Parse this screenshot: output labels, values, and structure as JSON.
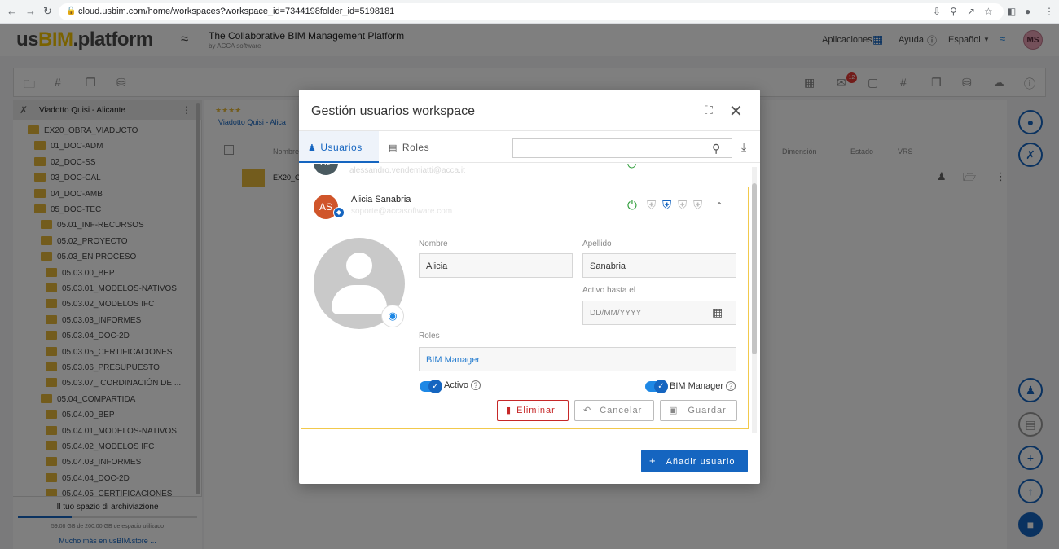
{
  "browser": {
    "url": "cloud.usbim.com/home/workspaces?workspace_id=7344198folder_id=5198181"
  },
  "header": {
    "logo_left": "us",
    "logo_bim": "BIM",
    "logo_right": ".platform",
    "tagline": "The Collaborative BIM Management Platform",
    "byline": "by ACCA software",
    "apps_label": "Aplicaciones",
    "help_label": "Ayuda",
    "lang_label": "Español",
    "user_initials": "MS"
  },
  "sidebar": {
    "project": "Viadotto Quisi - Alicante",
    "tree": [
      {
        "label": "EX20_OBRA_VIADUCTO",
        "level": 0
      },
      {
        "label": "01_DOC-ADM",
        "level": 1
      },
      {
        "label": "02_DOC-SS",
        "level": 1
      },
      {
        "label": "03_DOC-CAL",
        "level": 1
      },
      {
        "label": "04_DOC-AMB",
        "level": 1
      },
      {
        "label": "05_DOC-TEC",
        "level": 1
      },
      {
        "label": "05.01_INF-RECURSOS",
        "level": 2
      },
      {
        "label": "05.02_PROYECTO",
        "level": 2
      },
      {
        "label": "05.03_EN PROCESO",
        "level": 2
      },
      {
        "label": "05.03.00_BEP",
        "level": 3
      },
      {
        "label": "05.03.01_MODELOS-NATIVOS",
        "level": 3
      },
      {
        "label": "05.03.02_MODELOS IFC",
        "level": 3
      },
      {
        "label": "05.03.03_INFORMES",
        "level": 3
      },
      {
        "label": "05.03.04_DOC-2D",
        "level": 3
      },
      {
        "label": "05.03.05_CERTIFICACIONES",
        "level": 3
      },
      {
        "label": "05.03.06_PRESUPUESTO",
        "level": 3
      },
      {
        "label": "05.03.07_ CORDINACIÓN DE ...",
        "level": 3
      },
      {
        "label": "05.04_COMPARTIDA",
        "level": 2
      },
      {
        "label": "05.04.00_BEP",
        "level": 3
      },
      {
        "label": "05.04.01_MODELOS-NATIVOS",
        "level": 3
      },
      {
        "label": "05.04.02_MODELOS IFC",
        "level": 3
      },
      {
        "label": "05.04.03_INFORMES",
        "level": 3
      },
      {
        "label": "05.04.04_DOC-2D",
        "level": 3
      },
      {
        "label": "05.04.05_CERTIFICACIONES",
        "level": 3
      }
    ],
    "storage_title": "Il tuo spazio di archiviazione",
    "storage_used": "59.08 GB de 200.00 GB de espacio utilizado",
    "storage_fraction": 0.3,
    "storage_link": "Mucho más en usBIM.store ..."
  },
  "content": {
    "stars": "★★★★",
    "breadcrumb": "Viadotto Quisi - Alica",
    "col_name": "Nombre",
    "col_size": "Dimensión",
    "col_status": "Estado",
    "col_vrs": "VRS",
    "row_name": "EX20_O",
    "notif_count": "12"
  },
  "modal": {
    "title": "Gestión usuarios workspace",
    "tab_users": "Usuarios",
    "tab_roles": "Roles",
    "search_placeholder": "",
    "prev_user_initials": "AV",
    "prev_user_email": "alessandro.vendemiatti@acca.it",
    "user": {
      "initials": "AS",
      "name": "Alicia Sanabria",
      "email": "soporte@accasoftware.com",
      "label_nombre": "Nombre",
      "nombre": "Alicia",
      "label_apellido": "Apellido",
      "apellido": "Sanabria",
      "label_activo_hasta": "Activo hasta el",
      "date_placeholder": "DD/MM/YYYY",
      "label_roles": "Roles",
      "roles": "BIM Manager",
      "toggle_activo": "Activo",
      "toggle_bim_manager": "BIM Manager"
    },
    "btn_delete": "Eliminar",
    "btn_cancel": "Cancelar",
    "btn_save": "Guardar",
    "btn_add": "Añadir usuario"
  },
  "colors": {
    "accent": "#1565c0",
    "danger": "#c62828",
    "highlight": "#f2c94c",
    "folder": "#e6b93a"
  }
}
